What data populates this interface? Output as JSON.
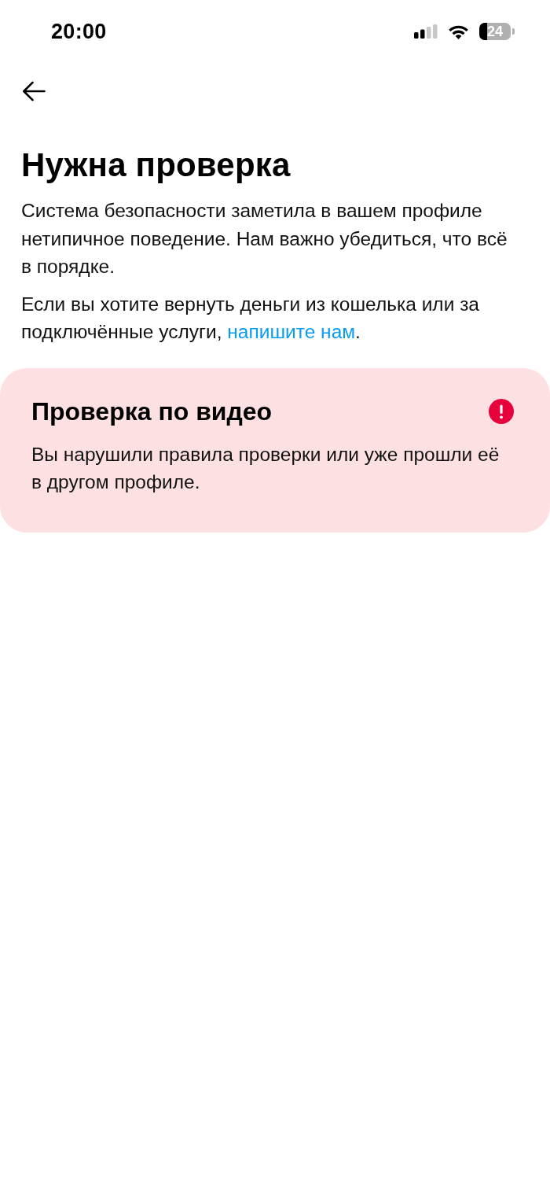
{
  "status_bar": {
    "time": "20:00",
    "battery": "24"
  },
  "title": "Нужна проверка",
  "paragraphs": [
    {
      "text": "Система безопасности заметила в вашем профиле нетипичное поведение. Нам важно убедиться, что всё в порядке."
    },
    {
      "text": "Если вы хотите вернуть деньги из кошелька или за подключённые услуги, ",
      "link": "напишите нам",
      "after": "."
    }
  ],
  "card": {
    "kind": "error",
    "title": "Проверка по видео",
    "text": "Вы нарушили правила проверки или уже прошли её в другом профиле."
  }
}
